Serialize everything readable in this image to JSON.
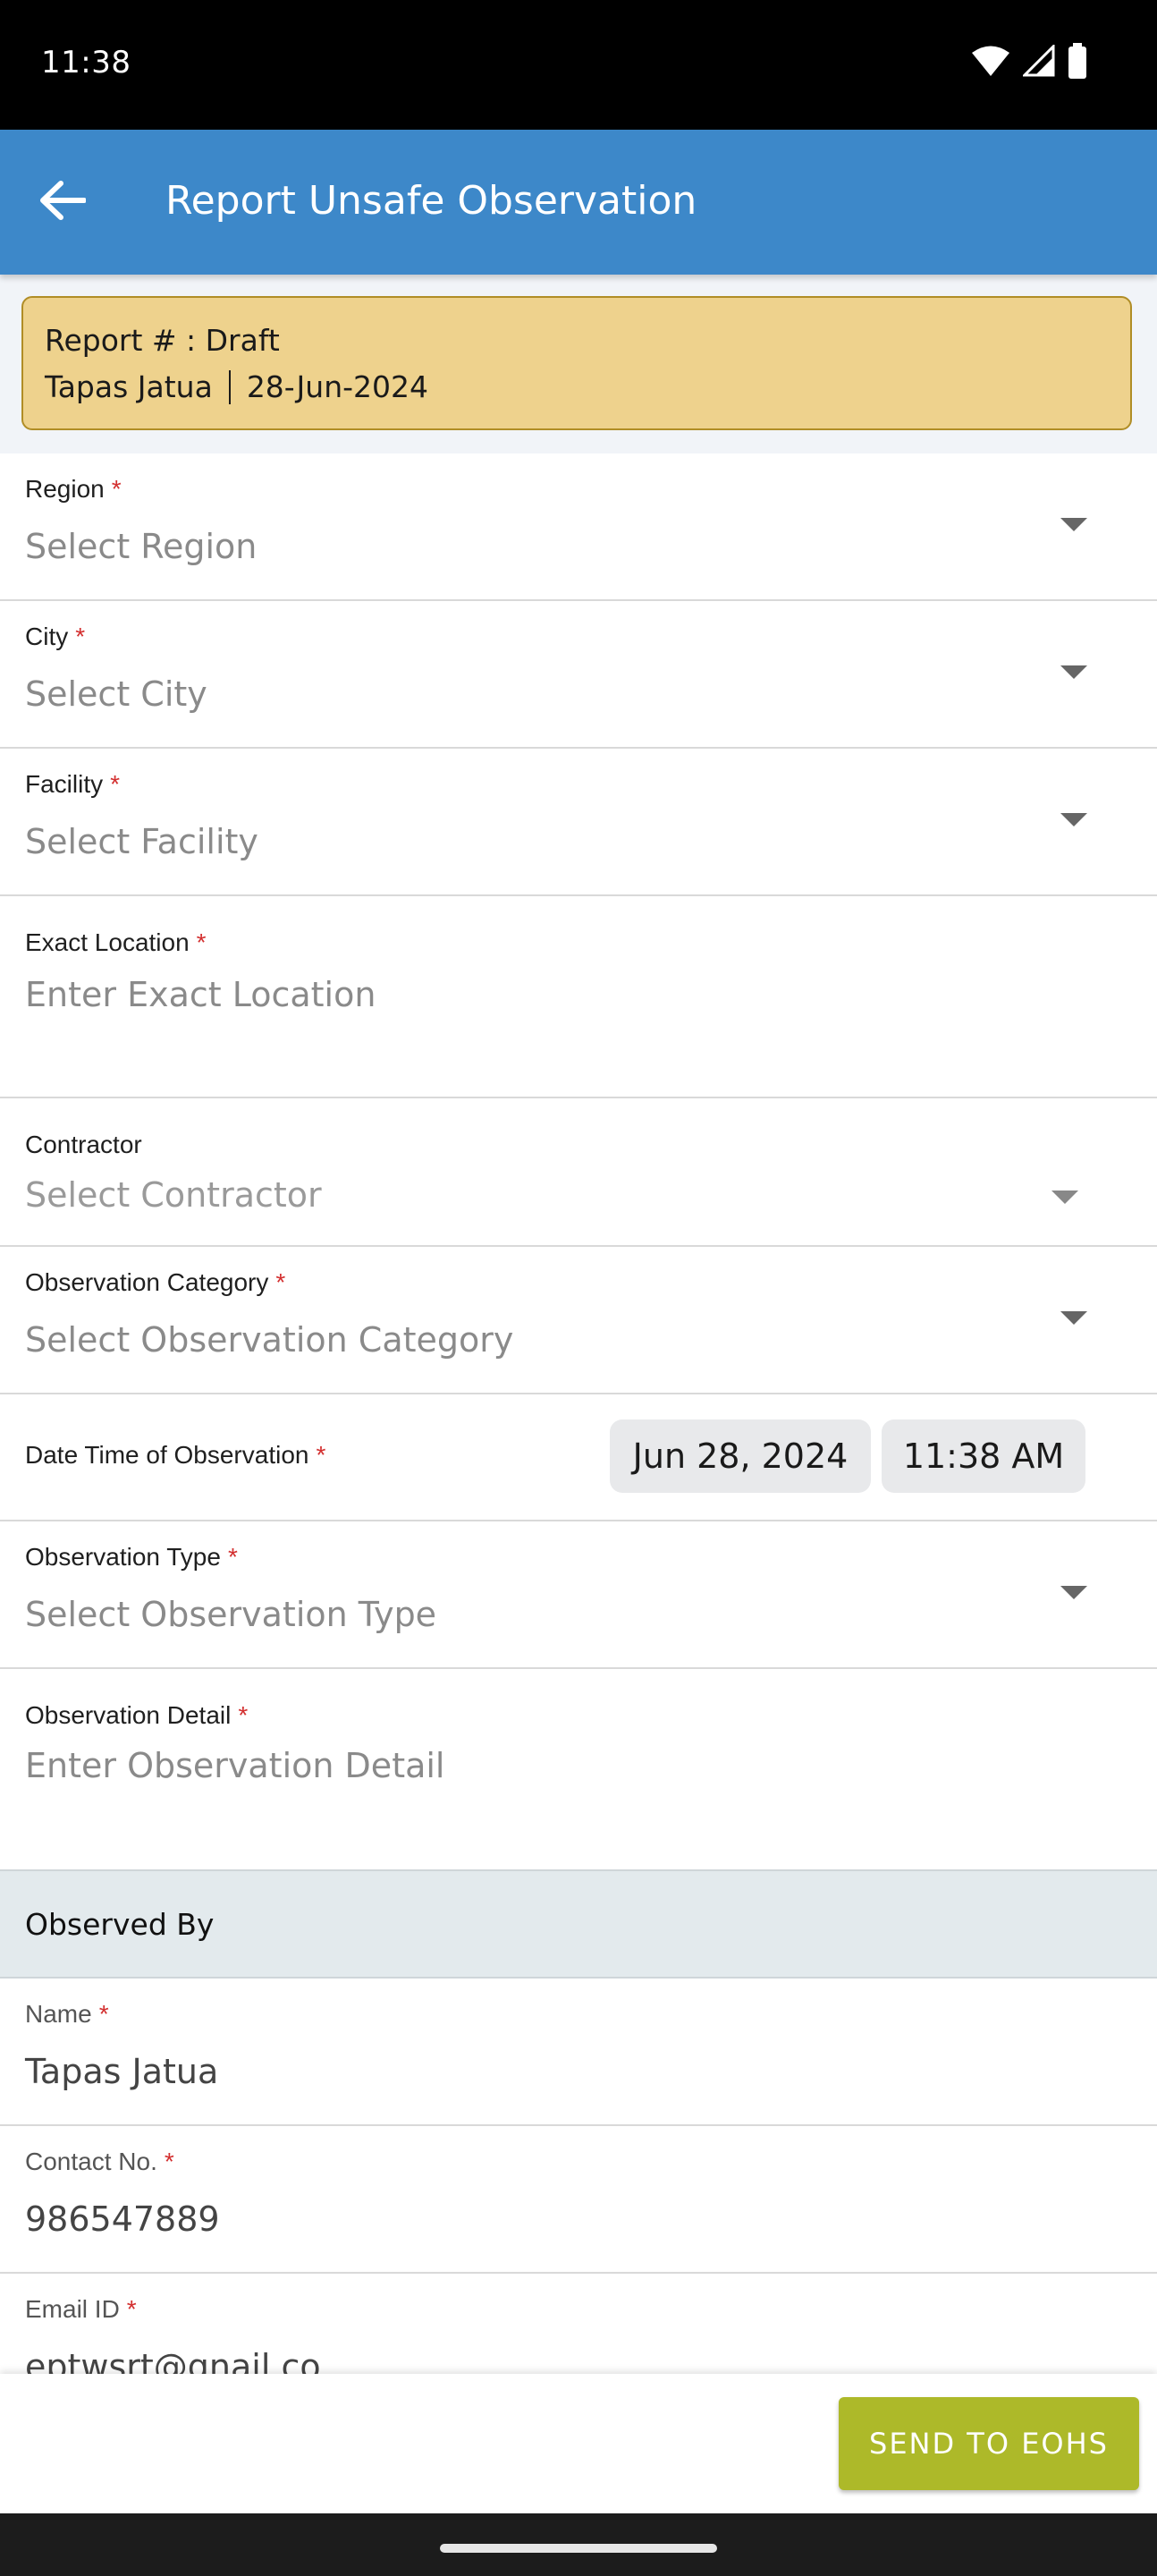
{
  "status_bar": {
    "time": "11:38",
    "icons": [
      "wifi-icon",
      "cellular-signal-icon",
      "battery-icon"
    ]
  },
  "app_bar": {
    "title": "Report Unsafe Observation",
    "back_icon": "arrow-back-icon",
    "color": "#3d88c9"
  },
  "draft_card": {
    "report_line": "Report # : Draft",
    "reporter": "Tapas Jatua",
    "date": "28-Jun-2024",
    "background": "#eed28d"
  },
  "form": {
    "region": {
      "label": "Region",
      "required_mark": "*",
      "placeholder": "Select Region"
    },
    "city": {
      "label": "City",
      "required_mark": "*",
      "placeholder": "Select City"
    },
    "facility": {
      "label": "Facility",
      "required_mark": "*",
      "placeholder": "Select Facility"
    },
    "exact_location": {
      "label": "Exact Location",
      "required_mark": "*",
      "placeholder": "Enter Exact Location"
    },
    "contractor": {
      "label": "Contractor",
      "placeholder": "Select Contractor"
    },
    "observation_category": {
      "label": "Observation Category",
      "required_mark": "*",
      "placeholder": "Select Observation Category"
    },
    "datetime": {
      "label": "Date Time of Observation",
      "required_mark": "*",
      "date": "Jun 28, 2024",
      "time": "11:38 AM"
    },
    "observation_type": {
      "label": "Observation Type",
      "required_mark": "*",
      "placeholder": "Select Observation Type"
    },
    "observation_detail": {
      "label": "Observation Detail",
      "required_mark": "*",
      "placeholder": "Enter Observation Detail"
    }
  },
  "observed_by": {
    "title": "Observed By",
    "name": {
      "label": "Name",
      "required_mark": "*",
      "value": "Tapas Jatua"
    },
    "contact": {
      "label": "Contact No.",
      "required_mark": "*",
      "value": "986547889"
    },
    "email": {
      "label": "Email ID",
      "required_mark": "*",
      "value": "eptwsrt@gnail.co"
    }
  },
  "actions": {
    "send_label": "SEND TO EOHS",
    "send_color": "#adb929"
  }
}
